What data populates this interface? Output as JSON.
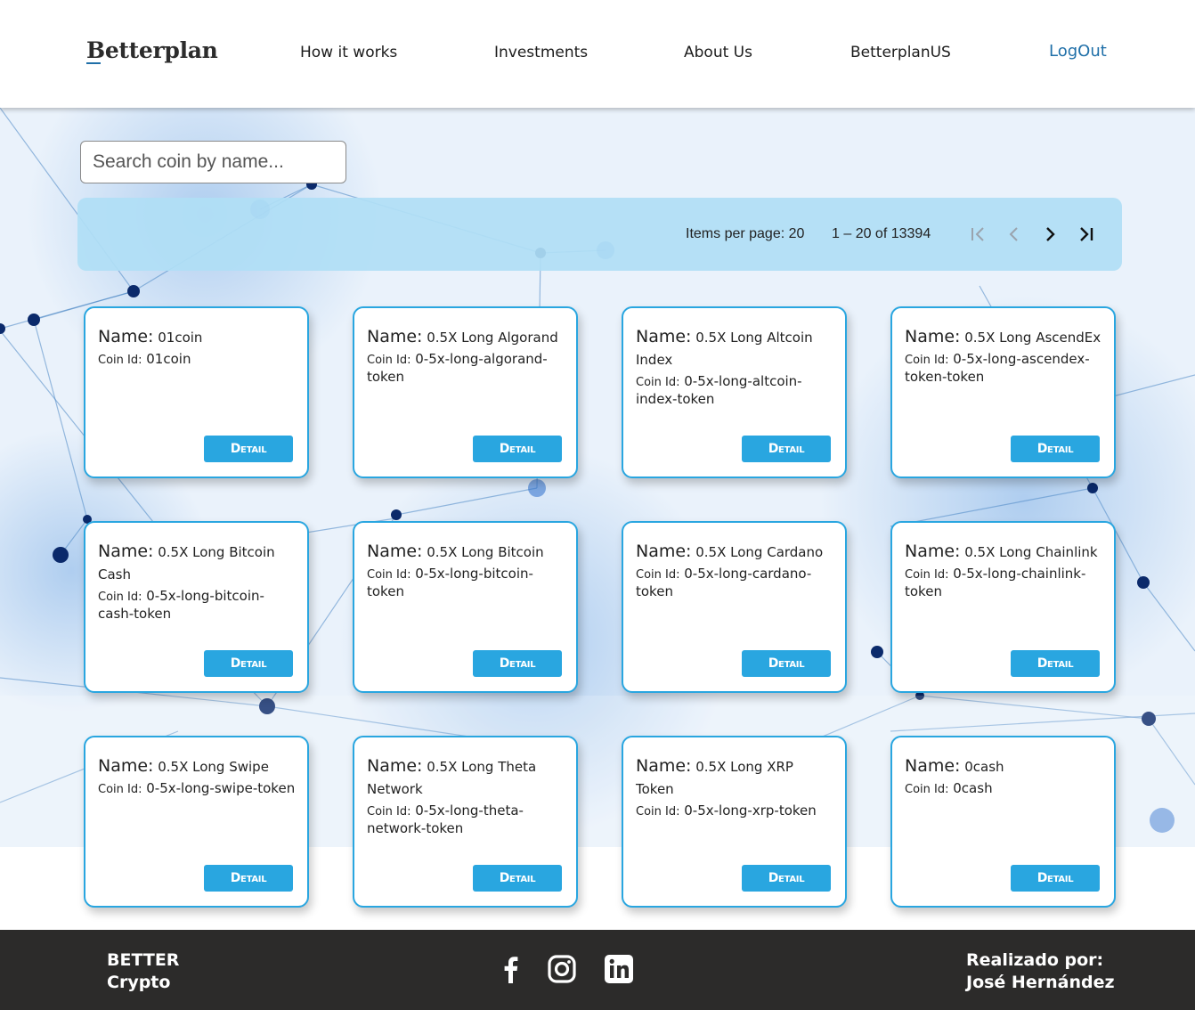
{
  "header": {
    "logo": "Betterplan",
    "nav": [
      {
        "label": "How it works"
      },
      {
        "label": "Investments"
      },
      {
        "label": "About Us"
      },
      {
        "label": "BetterplanUS"
      }
    ],
    "logout_label": "LogOut"
  },
  "search": {
    "placeholder": "Search coin by name..."
  },
  "paginator": {
    "items_per_page_label": "Items per page: 20",
    "range_label": "1 – 20 of 13394",
    "icons": [
      "first-page-icon",
      "previous-page-icon",
      "next-page-icon",
      "last-page-icon"
    ]
  },
  "card_labels": {
    "name": "Name:",
    "coin_id": "Coin Id:",
    "detail": "Detail"
  },
  "coins": [
    {
      "name": "01coin",
      "id": "01coin"
    },
    {
      "name": "0.5X Long Algorand",
      "id": "0-5x-long-algorand-token"
    },
    {
      "name": "0.5X Long Altcoin Index",
      "id": "0-5x-long-altcoin-index-token"
    },
    {
      "name": "0.5X Long AscendEx",
      "id": "0-5x-long-ascendex-token-token"
    },
    {
      "name": "0.5X Long Bitcoin Cash",
      "id": "0-5x-long-bitcoin-cash-token"
    },
    {
      "name": "0.5X Long Bitcoin",
      "id": "0-5x-long-bitcoin-token"
    },
    {
      "name": "0.5X Long Cardano",
      "id": "0-5x-long-cardano-token"
    },
    {
      "name": "0.5X Long Chainlink",
      "id": "0-5x-long-chainlink-token"
    },
    {
      "name": "0.5X Long Swipe",
      "id": "0-5x-long-swipe-token"
    },
    {
      "name": "0.5X Long Theta Network",
      "id": "0-5x-long-theta-network-token"
    },
    {
      "name": "0.5X Long XRP Token",
      "id": "0-5x-long-xrp-token"
    },
    {
      "name": "0cash",
      "id": "0cash"
    }
  ],
  "footer": {
    "brand_line1": "BETTER",
    "brand_line2": "Crypto",
    "credit_line1": "Realizado por:",
    "credit_line2": "José Hernández",
    "social": [
      "facebook-icon",
      "instagram-icon",
      "linkedin-icon"
    ]
  },
  "colors": {
    "accent": "#29a6e0",
    "paginator_bg": "#b0def5",
    "footer_bg": "#2c2b2a",
    "logout": "#1f6fa8"
  }
}
